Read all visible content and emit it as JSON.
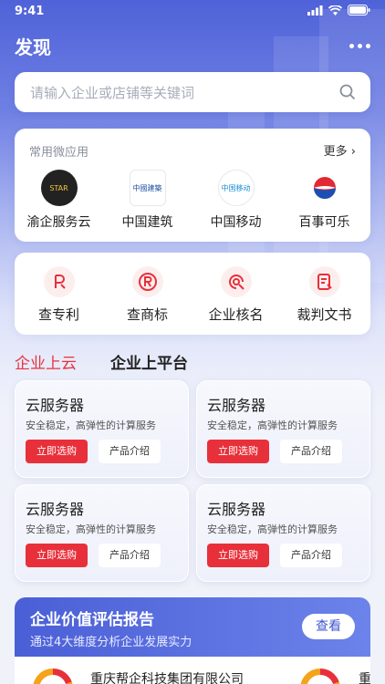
{
  "status": {
    "time": "9:41"
  },
  "header": {
    "title": "发现"
  },
  "search": {
    "placeholder": "请输入企业或店铺等关键词"
  },
  "apps": {
    "section_label": "常用微应用",
    "more_label": "更多",
    "items": [
      {
        "name": "渝企服务云",
        "logo_text": "STAR",
        "icon": "star-logo-icon"
      },
      {
        "name": "中国建筑",
        "logo_text": "中國建築",
        "icon": "cscec-logo-icon"
      },
      {
        "name": "中国移动",
        "logo_text": "中国移动",
        "icon": "china-mobile-logo-icon"
      },
      {
        "name": "百事可乐",
        "logo_text": "pepsi",
        "icon": "pepsi-logo-icon"
      }
    ]
  },
  "tools": {
    "items": [
      {
        "name": "查专利",
        "icon": "patent-icon"
      },
      {
        "name": "查商标",
        "icon": "trademark-icon"
      },
      {
        "name": "企业核名",
        "icon": "company-name-check-icon"
      },
      {
        "name": "裁判文书",
        "icon": "judgment-document-icon"
      }
    ]
  },
  "tabs": [
    {
      "label": "企业上云",
      "active": true
    },
    {
      "label": "企业上平台",
      "active": false
    }
  ],
  "products": [
    {
      "title": "云服务器",
      "desc": "安全稳定，高弹性的计算服务",
      "buy": "立即选购",
      "intro": "产品介绍"
    },
    {
      "title": "云服务器",
      "desc": "安全稳定，高弹性的计算服务",
      "buy": "立即选购",
      "intro": "产品介绍"
    },
    {
      "title": "云服务器",
      "desc": "安全稳定，高弹性的计算服务",
      "buy": "立即选购",
      "intro": "产品介绍"
    },
    {
      "title": "云服务器",
      "desc": "安全稳定，高弹性的计算服务",
      "buy": "立即选购",
      "intro": "产品介绍"
    }
  ],
  "report": {
    "title": "企业价值评估报告",
    "subtitle": "通过4大维度分析企业发展实力",
    "view_label": "查看",
    "company": "重庆帮企科技集团有限公司",
    "company2": "重"
  },
  "colors": {
    "accent": "#e8303a",
    "brand": "#4a5fd6"
  }
}
